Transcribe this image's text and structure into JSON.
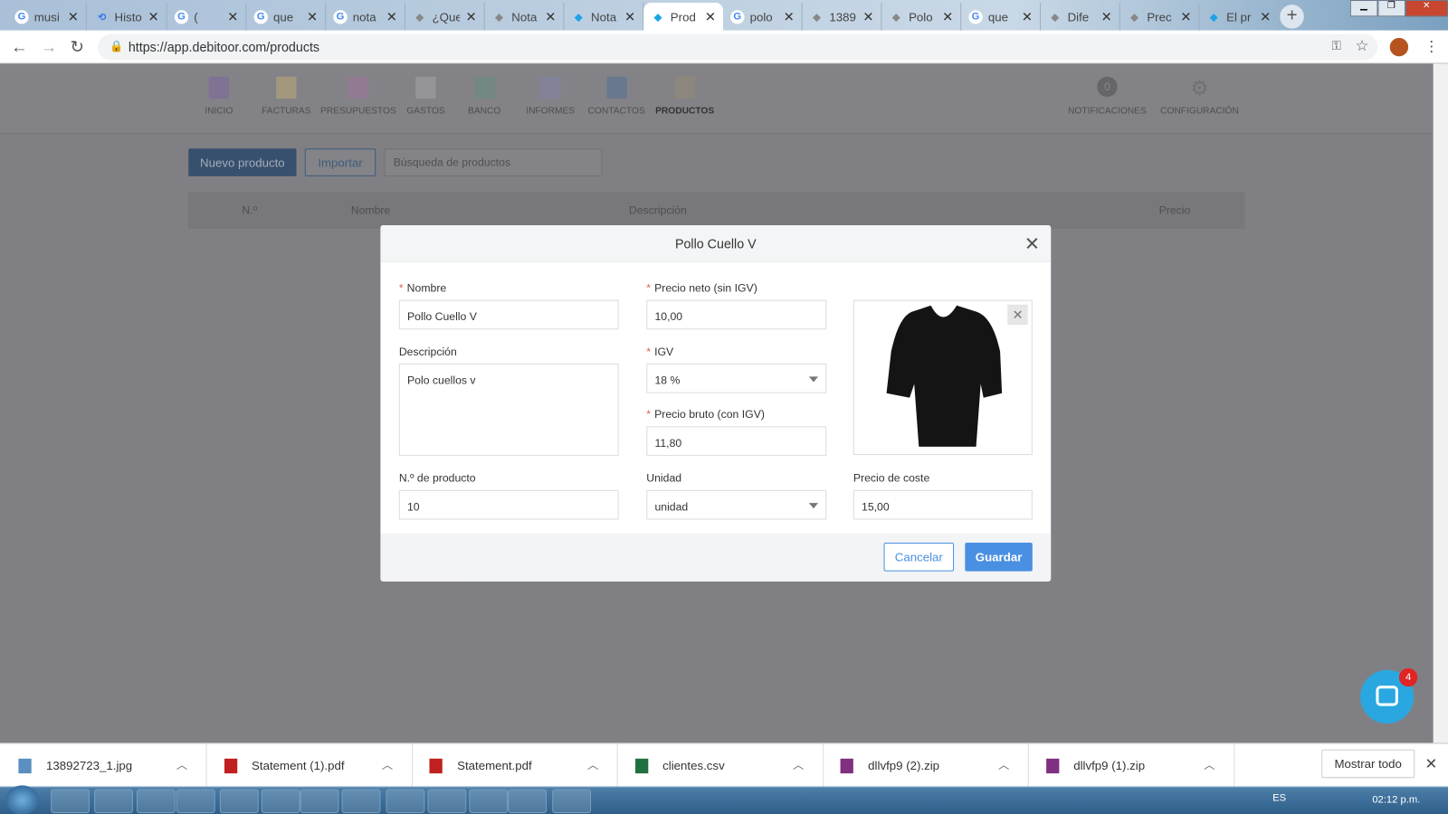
{
  "browser": {
    "tabs": [
      {
        "title": "musi",
        "icon": "google"
      },
      {
        "title": "Histo",
        "icon": "history"
      },
      {
        "title": "(",
        "icon": "google"
      },
      {
        "title": "que",
        "icon": "google"
      },
      {
        "title": "nota",
        "icon": "google"
      },
      {
        "title": "¿Que",
        "icon": "site"
      },
      {
        "title": "Nota",
        "icon": "site"
      },
      {
        "title": "Nota",
        "icon": "debitoor"
      },
      {
        "title": "Prod",
        "icon": "debitoor",
        "active": true
      },
      {
        "title": "polo",
        "icon": "google"
      },
      {
        "title": "1389",
        "icon": "site"
      },
      {
        "title": "Polo",
        "icon": "site"
      },
      {
        "title": "que",
        "icon": "google"
      },
      {
        "title": "Dife",
        "icon": "site"
      },
      {
        "title": "Prec",
        "icon": "site"
      },
      {
        "title": "El pr",
        "icon": "debitoor"
      }
    ],
    "url": "https://app.debitoor.com/products"
  },
  "app": {
    "nav": [
      {
        "label": "INICIO",
        "color": "#7b5ea7"
      },
      {
        "label": "FACTURAS",
        "color": "#c9b070"
      },
      {
        "label": "PRESUPUESTOS",
        "color": "#a070a0"
      },
      {
        "label": "GASTOS",
        "color": "#aaaaaa"
      },
      {
        "label": "BANCO",
        "color": "#5f8f7f"
      },
      {
        "label": "INFORMES",
        "color": "#8080b0"
      },
      {
        "label": "CONTACTOS",
        "color": "#4a6a9a"
      },
      {
        "label": "PRODUCTOS",
        "color": "#9a8a70",
        "active": true
      }
    ],
    "notifications": {
      "label": "NOTIFICACIONES",
      "count": "0"
    },
    "settings": {
      "label": "CONFIGURACIÓN"
    },
    "new_product": "Nuevo producto",
    "import": "Importar",
    "search_placeholder": "Búsqueda de productos",
    "columns": [
      "N.º",
      "Nombre",
      "Descripción",
      "Precio"
    ]
  },
  "modal": {
    "title": "Pollo Cuello V",
    "nombre_label": "Nombre",
    "nombre": "Pollo Cuello V",
    "descripcion_label": "Descripción",
    "descripcion": "Polo cuellos v",
    "numero_label": "N.º de producto",
    "numero": "10",
    "precio_neto_label": "Precio neto (sin IGV)",
    "precio_neto": "10,00",
    "igv_label": "IGV",
    "igv": "18 %",
    "precio_bruto_label": "Precio bruto (con IGV)",
    "precio_bruto": "11,80",
    "unidad_label": "Unidad",
    "unidad": "unidad",
    "coste_label": "Precio de coste",
    "coste": "15,00",
    "cancel": "Cancelar",
    "save": "Guardar",
    "accent": "#4a90e2"
  },
  "chat": {
    "badge": "4"
  },
  "downloads": {
    "items": [
      {
        "name": "13892723_1.jpg",
        "type": "image"
      },
      {
        "name": "Statement (1).pdf",
        "type": "pdf"
      },
      {
        "name": "Statement.pdf",
        "type": "pdf"
      },
      {
        "name": "clientes.csv",
        "type": "excel"
      },
      {
        "name": "dllvfp9 (2).zip",
        "type": "rar"
      },
      {
        "name": "dllvfp9 (1).zip",
        "type": "rar"
      }
    ],
    "show_all": "Mostrar todo"
  },
  "taskbar": {
    "lang": "ES",
    "time": "02:12 p.m."
  }
}
